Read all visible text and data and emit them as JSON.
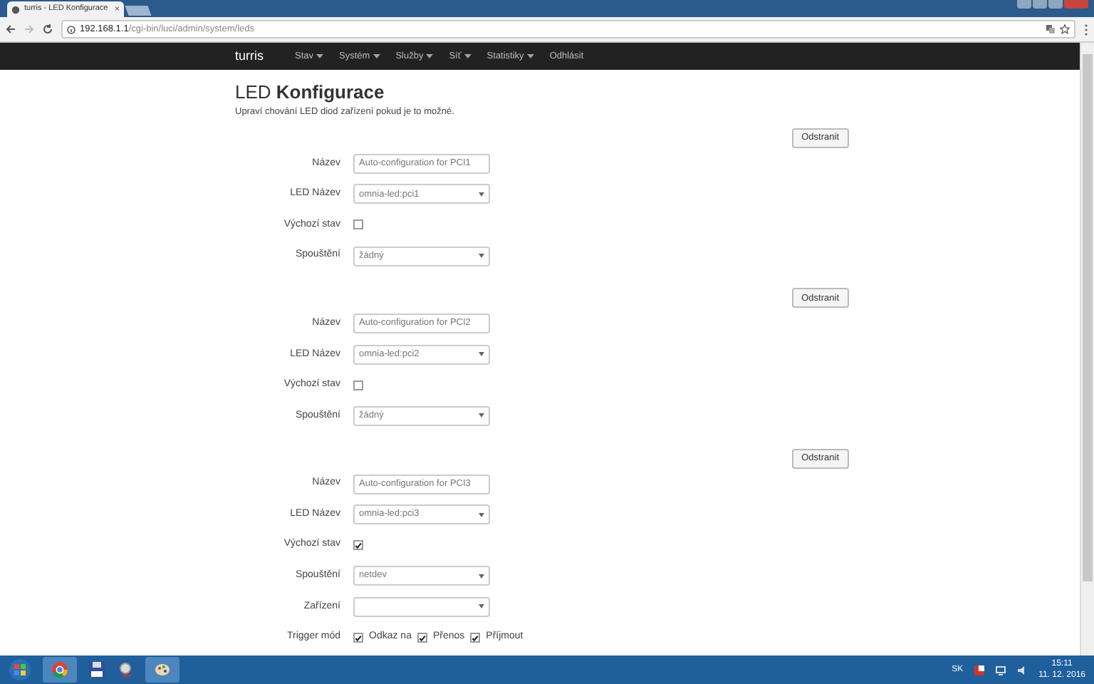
{
  "browser": {
    "tab_title": "turris - LED Konfigurace",
    "tab_close": "×",
    "url_host": "192.168.1.1",
    "url_path": "/cgi-bin/luci/admin/system/leds"
  },
  "navbar": {
    "brand": "turris",
    "items": [
      {
        "label": "Stav",
        "caret": true
      },
      {
        "label": "Systém",
        "caret": true
      },
      {
        "label": "Služby",
        "caret": true
      },
      {
        "label": "Síť",
        "caret": true
      },
      {
        "label": "Statistiky",
        "caret": true
      },
      {
        "label": "Odhlásit",
        "caret": false
      }
    ]
  },
  "heading": "LED **Konfigurace**",
  "description": "Upraví chování LED diod zařízení pokud je to možné.",
  "sections": [
    {
      "remove_button": "Odstranit",
      "fields": [
        {
          "kind": "text",
          "label": "Název",
          "value": "Auto-configuration for PCI1"
        },
        {
          "kind": "select",
          "label": "LED Název",
          "value": "omnia-led:pci1"
        },
        {
          "kind": "checkbox",
          "label": "Výchozí stav",
          "checked": false
        },
        {
          "kind": "select",
          "label": "Spouštění",
          "value": "žádný"
        }
      ]
    },
    {
      "remove_button": "Odstranit",
      "fields": [
        {
          "kind": "text",
          "label": "Název",
          "value": "Auto-configuration for PCI2"
        },
        {
          "kind": "select",
          "label": "LED Název",
          "value": "omnia-led:pci2"
        },
        {
          "kind": "checkbox",
          "label": "Výchozí stav",
          "checked": false
        },
        {
          "kind": "select",
          "label": "Spouštění",
          "value": "žádný"
        }
      ]
    },
    {
      "remove_button": "Odstranit",
      "fields": [
        {
          "kind": "text",
          "label": "Název",
          "value": "Auto-configuration for PCI3"
        },
        {
          "kind": "select",
          "label": "LED Název",
          "value": "omnia-led:pci3"
        },
        {
          "kind": "checkbox",
          "label": "Výchozí stav",
          "checked": true
        },
        {
          "kind": "select",
          "label": "Spouštění",
          "value": "netdev"
        },
        {
          "kind": "select",
          "label": "Zařízení"
        },
        {
          "kind": "checkgroup",
          "label": "Trigger mód",
          "options": [
            {
              "label": "Odkaz na",
              "checked": true
            },
            {
              "label": "Přenos",
              "checked": true
            },
            {
              "label": "Příjmout",
              "checked": true
            }
          ]
        }
      ]
    }
  ],
  "taskbar": {
    "language": "SK",
    "time": "15:11",
    "date": "11. 12. 2016"
  }
}
